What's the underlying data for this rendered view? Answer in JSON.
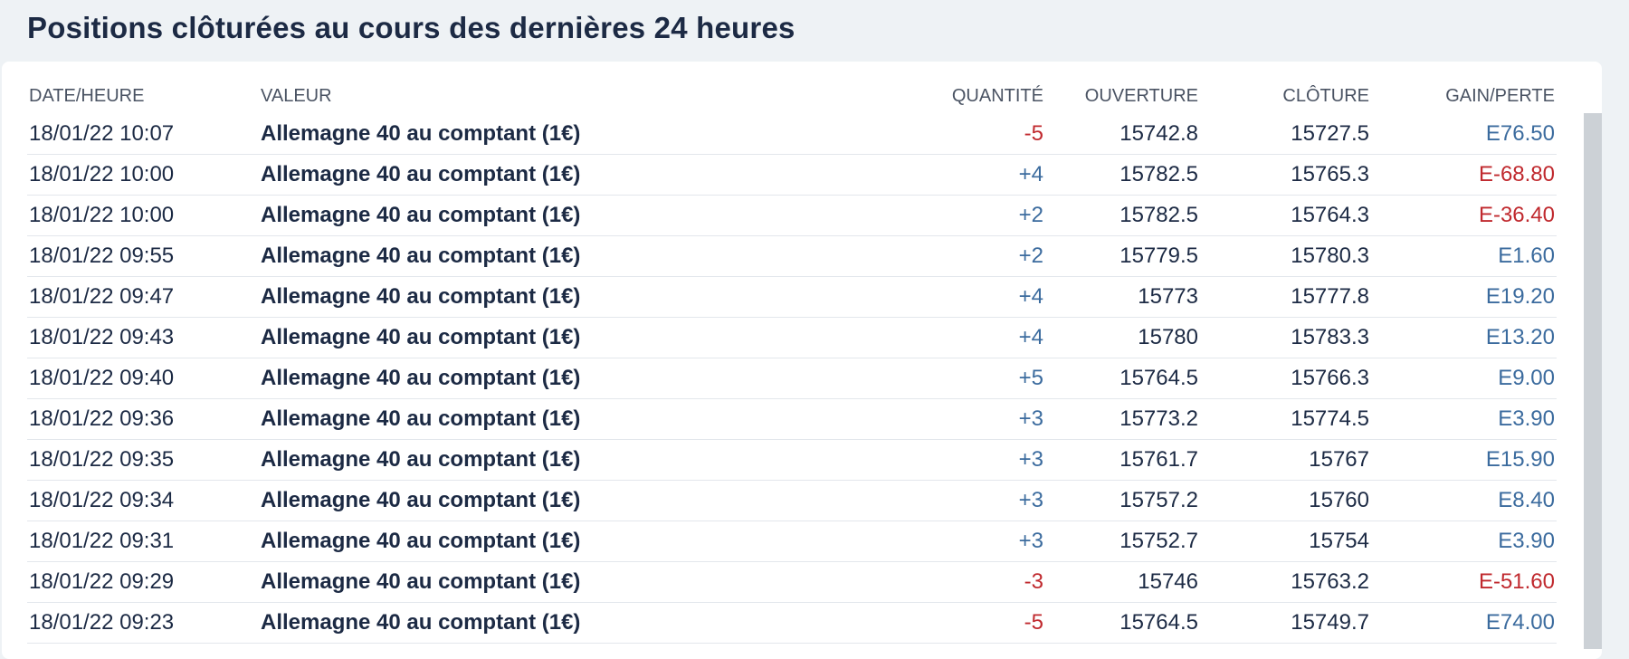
{
  "title": "Positions clôturées au cours des dernières 24 heures",
  "colors": {
    "gain": "#3b6b9e",
    "loss": "#c0292e",
    "text": "#1c2a44"
  },
  "columns": {
    "date": "DATE/HEURE",
    "value": "VALEUR",
    "quantity": "QUANTITÉ",
    "open": "OUVERTURE",
    "close": "CLÔTURE",
    "pl": "GAIN/PERTE"
  },
  "rows": [
    {
      "date": "18/01/22 10:07",
      "value": "Allemagne 40 au comptant (1€)",
      "quantity": "-5",
      "open": "15742.8",
      "close": "15727.5",
      "pl": "E76.50",
      "qty_sign": "neg",
      "pl_sign": "pos"
    },
    {
      "date": "18/01/22 10:00",
      "value": "Allemagne 40 au comptant (1€)",
      "quantity": "+4",
      "open": "15782.5",
      "close": "15765.3",
      "pl": "E-68.80",
      "qty_sign": "pos",
      "pl_sign": "neg"
    },
    {
      "date": "18/01/22 10:00",
      "value": "Allemagne 40 au comptant (1€)",
      "quantity": "+2",
      "open": "15782.5",
      "close": "15764.3",
      "pl": "E-36.40",
      "qty_sign": "pos",
      "pl_sign": "neg"
    },
    {
      "date": "18/01/22 09:55",
      "value": "Allemagne 40 au comptant (1€)",
      "quantity": "+2",
      "open": "15779.5",
      "close": "15780.3",
      "pl": "E1.60",
      "qty_sign": "pos",
      "pl_sign": "pos"
    },
    {
      "date": "18/01/22 09:47",
      "value": "Allemagne 40 au comptant (1€)",
      "quantity": "+4",
      "open": "15773",
      "close": "15777.8",
      "pl": "E19.20",
      "qty_sign": "pos",
      "pl_sign": "pos"
    },
    {
      "date": "18/01/22 09:43",
      "value": "Allemagne 40 au comptant (1€)",
      "quantity": "+4",
      "open": "15780",
      "close": "15783.3",
      "pl": "E13.20",
      "qty_sign": "pos",
      "pl_sign": "pos"
    },
    {
      "date": "18/01/22 09:40",
      "value": "Allemagne 40 au comptant (1€)",
      "quantity": "+5",
      "open": "15764.5",
      "close": "15766.3",
      "pl": "E9.00",
      "qty_sign": "pos",
      "pl_sign": "pos"
    },
    {
      "date": "18/01/22 09:36",
      "value": "Allemagne 40 au comptant (1€)",
      "quantity": "+3",
      "open": "15773.2",
      "close": "15774.5",
      "pl": "E3.90",
      "qty_sign": "pos",
      "pl_sign": "pos"
    },
    {
      "date": "18/01/22 09:35",
      "value": "Allemagne 40 au comptant (1€)",
      "quantity": "+3",
      "open": "15761.7",
      "close": "15767",
      "pl": "E15.90",
      "qty_sign": "pos",
      "pl_sign": "pos"
    },
    {
      "date": "18/01/22 09:34",
      "value": "Allemagne 40 au comptant (1€)",
      "quantity": "+3",
      "open": "15757.2",
      "close": "15760",
      "pl": "E8.40",
      "qty_sign": "pos",
      "pl_sign": "pos"
    },
    {
      "date": "18/01/22 09:31",
      "value": "Allemagne 40 au comptant (1€)",
      "quantity": "+3",
      "open": "15752.7",
      "close": "15754",
      "pl": "E3.90",
      "qty_sign": "pos",
      "pl_sign": "pos"
    },
    {
      "date": "18/01/22 09:29",
      "value": "Allemagne 40 au comptant (1€)",
      "quantity": "-3",
      "open": "15746",
      "close": "15763.2",
      "pl": "E-51.60",
      "qty_sign": "neg",
      "pl_sign": "neg"
    },
    {
      "date": "18/01/22 09:23",
      "value": "Allemagne 40 au comptant (1€)",
      "quantity": "-5",
      "open": "15764.5",
      "close": "15749.7",
      "pl": "E74.00",
      "qty_sign": "neg",
      "pl_sign": "pos"
    }
  ]
}
